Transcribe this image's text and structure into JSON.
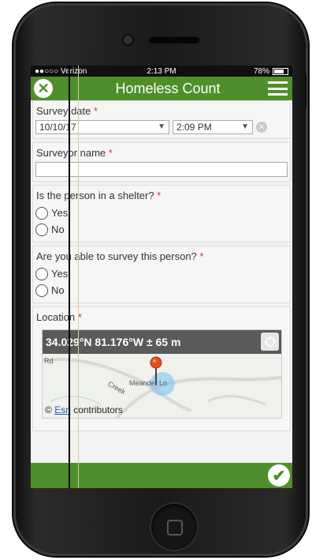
{
  "status_bar": {
    "carrier": "●●○○○ Verizon",
    "time": "2:13 PM",
    "battery": "78%"
  },
  "header": {
    "title": "Homeless Count"
  },
  "fields": {
    "survey_date": {
      "label": "Survey date",
      "date_value": "10/10/17",
      "time_value": "2:09 PM"
    },
    "surveyor_name": {
      "label": "Surveyor name",
      "value": ""
    },
    "shelter": {
      "label": "Is the person in a shelter?",
      "options": [
        "Yes",
        "No"
      ]
    },
    "able_to_survey": {
      "label": "Are you able to survey this person?",
      "options": [
        "Yes",
        "No"
      ]
    },
    "location": {
      "label": "Location",
      "coordinates": "34.029°N 81.176°W ± 65 m",
      "road_labels": [
        "Rd",
        "Creek",
        "Meander Ln"
      ],
      "attribution_prefix": "©",
      "attribution_link": "Esri",
      "attribution_suffix": "contributors"
    }
  },
  "required_mark": "*",
  "colors": {
    "accent": "#4f8f2b",
    "required": "#d9352b",
    "pin": "#e84b1e"
  },
  "icons": [
    "close-icon",
    "menu-icon",
    "chevron-down-icon",
    "clear-icon",
    "locate-icon",
    "map-pin-icon",
    "checkmark-icon"
  ]
}
